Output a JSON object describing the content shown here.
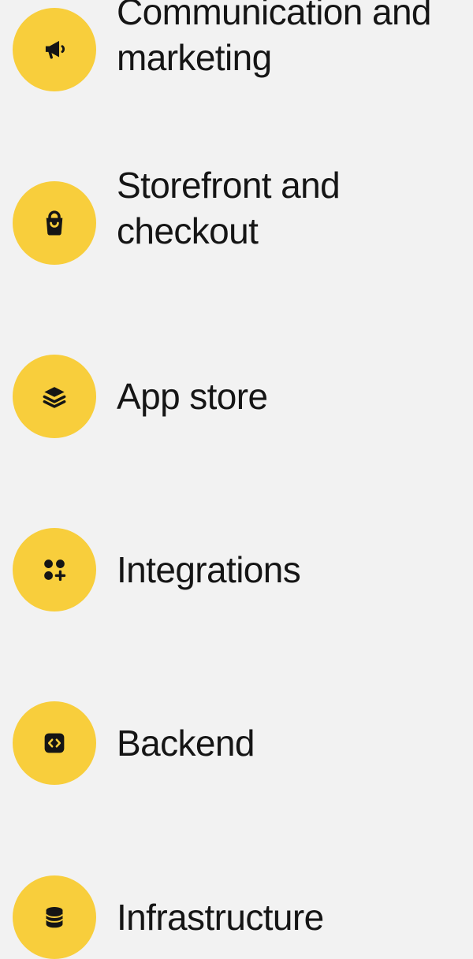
{
  "feature_list": {
    "items": [
      {
        "icon": "megaphone-icon",
        "line1": "Communication and",
        "line2": "marketing"
      },
      {
        "icon": "shopping-bag-icon",
        "line1": "Storefront and",
        "line2": "checkout"
      },
      {
        "icon": "layers-icon",
        "line1": "App store"
      },
      {
        "icon": "apps-plus-icon",
        "line1": "Integrations"
      },
      {
        "icon": "code-window-icon",
        "line1": "Backend"
      },
      {
        "icon": "database-icon",
        "line1": "Infrastructure"
      }
    ]
  },
  "colors": {
    "background": "#f2f2f2",
    "icon_circle": "#f8ce3c",
    "text": "#151515",
    "icon_glyph": "#151515"
  }
}
